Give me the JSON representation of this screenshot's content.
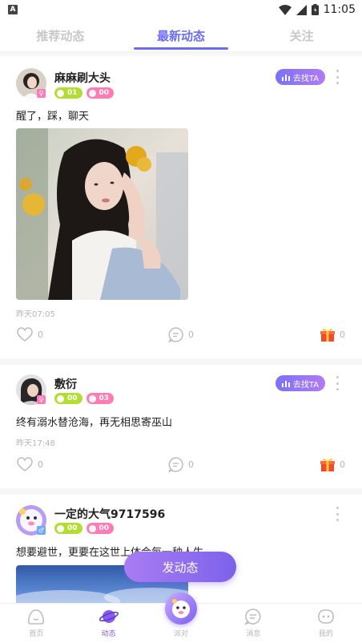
{
  "status_bar": {
    "time": "11:05",
    "app_letter": "A"
  },
  "tabs": [
    {
      "label": "推荐动态",
      "active": false
    },
    {
      "label": "最新动态",
      "active": true
    },
    {
      "label": "关注",
      "active": false
    }
  ],
  "posts": [
    {
      "username": "麻麻刷大头",
      "level": "01",
      "hearts": "00",
      "find_label": "去找TA",
      "text": "醒了，踩，聊天",
      "time": "昨天07:05",
      "likes": "0",
      "comments": "0",
      "gifts": "0"
    },
    {
      "username": "敷衍",
      "level": "00",
      "hearts": "03",
      "find_label": "去找TA",
      "text": "终有溺水替沧海，再无相思寄巫山",
      "time": "昨天17:48",
      "likes": "0",
      "comments": "0",
      "gifts": "0"
    },
    {
      "username": "一定的大气9717596",
      "level": "00",
      "hearts": "00",
      "text": "想要避世，更要在这世上体会每一种人生"
    }
  ],
  "fab": {
    "label": "发动态"
  },
  "bottom_nav": [
    {
      "label": "首页",
      "icon": "home-icon"
    },
    {
      "label": "动态",
      "icon": "planet-icon",
      "active": true
    },
    {
      "label": "派对",
      "icon": "party-icon"
    },
    {
      "label": "消息",
      "icon": "message-icon"
    },
    {
      "label": "我的",
      "icon": "profile-icon"
    }
  ],
  "colors": {
    "accent": "#6b6cf6",
    "purple": "#8a5cf0",
    "pink": "#ff7cb3",
    "green": "#b3dd35"
  }
}
